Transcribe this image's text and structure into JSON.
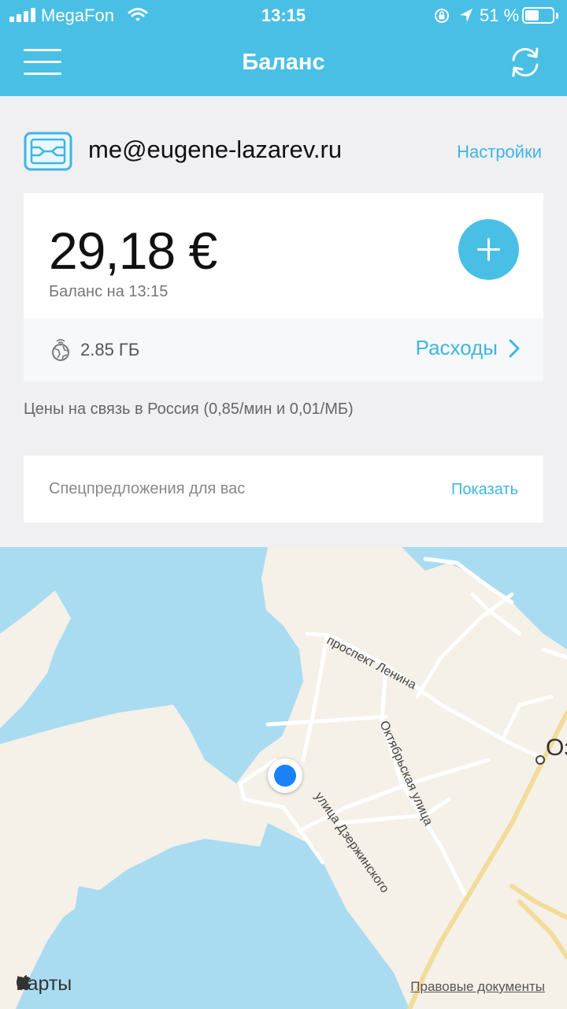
{
  "status_bar": {
    "carrier": "MegaFon",
    "time": "13:15",
    "battery": "51 %",
    "battery_level": 0.51
  },
  "header": {
    "title": "Баланс"
  },
  "account": {
    "email": "me@eugene-lazarev.ru",
    "settings_label": "Настройки"
  },
  "balance": {
    "amount": "29,18 €",
    "subtitle": "Баланс на 13:15",
    "traffic": "2.85 ГБ",
    "expenses_label": "Расходы"
  },
  "tariff_info": "Цены на связь в Россия (0,85/мин и 0,01/МБ)",
  "offers": {
    "label": "Спецпредложения для вас",
    "action": "Показать"
  },
  "map": {
    "street_1": "проспект Ленина",
    "street_2": "Октябрьская улица",
    "street_3": "улица Дзержинского",
    "city_fragment": "Oз",
    "brand": "Карты",
    "legal": "Правовые документы"
  },
  "colors": {
    "accent": "#49bfe6",
    "link": "#3fb6e2",
    "water": "#a9dcf0",
    "land": "#f5f0e8",
    "location": "#1a82f7"
  },
  "icons": [
    "signal-icon",
    "wifi-icon",
    "rotation-lock-icon",
    "location-arrow-icon",
    "battery-icon",
    "menu-icon",
    "refresh-icon",
    "sim-card-icon",
    "plus-icon",
    "roaming-globe-icon",
    "chevron-right-icon",
    "apple-logo-icon"
  ]
}
